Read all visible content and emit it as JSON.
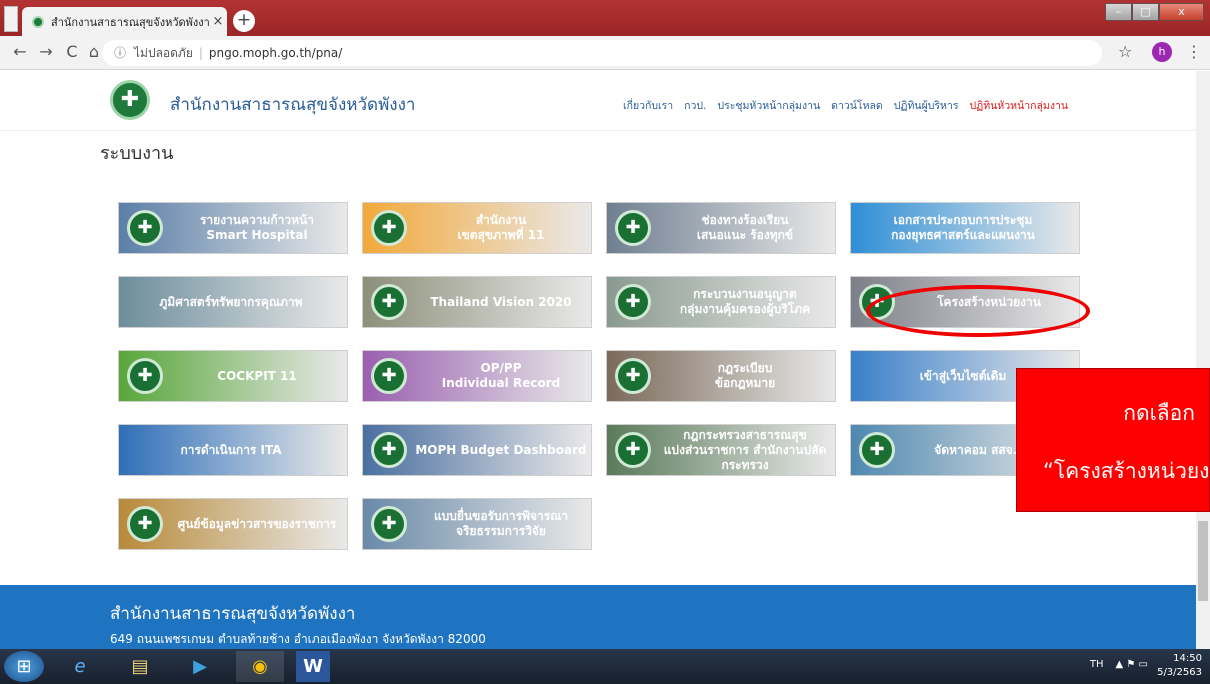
{
  "browser": {
    "tab_title": "สำนักงานสาธารณสุขจังหวัดพังงา",
    "tab_close": "×",
    "new_tab": "+",
    "win_min": "–",
    "win_max": "□",
    "win_close": "x",
    "back": "←",
    "forward": "→",
    "reload": "C",
    "home": "⌂",
    "info_icon": "ⓘ",
    "security_label": "ไม่ปลอดภัย",
    "url": "pngo.moph.go.th/pna/",
    "star": "☆",
    "profile_initial": "h",
    "menu": "⋮"
  },
  "site": {
    "name": "สำนักงานสาธารณสุขจังหวัดพังงา",
    "logo_glyph": "✚",
    "nav": [
      "เกี่ยวกับเรา",
      "กวป.",
      "ประชุมหัวหน้ากลุ่มงาน",
      "ดาวน์โหลด",
      "ปฏิทินผู้บริหาร",
      "ปฏิทินหัวหน้ากลุ่มงาน"
    ],
    "section_title": "ระบบงาน"
  },
  "tiles": [
    {
      "l1": "รายงานความก้าวหน้า",
      "l2": "Smart Hospital",
      "bg": "#5b7fa8",
      "badge": true
    },
    {
      "l1": "สำนักงาน",
      "l2": "เขตสุขภาพที่ 11",
      "bg": "#f2a93b",
      "badge": true
    },
    {
      "l1": "ช่องทางร้องเรียน",
      "l2": "เสนอแนะ ร้องทุกข์",
      "bg": "#6f7f91",
      "badge": true
    },
    {
      "l1": "เอกสารประกอบการประชุม",
      "l2": "กองยุทธศาสตร์และแผนงาน",
      "bg": "#2f8fd6",
      "badge": false
    },
    {
      "l1": "ภูมิศาสตร์ทรัพยากรคุณภาพ",
      "l2": "",
      "bg": "#6d8d9c",
      "badge": false
    },
    {
      "l1": "Thailand Vision 2020",
      "l2": "",
      "bg": "#8c8f7a",
      "badge": true
    },
    {
      "l1": "กระบวนงานอนุญาต",
      "l2": "กลุ่มงานคุ้มครองผู้บริโภค",
      "bg": "#8a9a90",
      "badge": true
    },
    {
      "l1": "โครงสร้างหน่วยงาน",
      "l2": "",
      "bg": "#7d7f88",
      "badge": true
    },
    {
      "l1": "COCKPIT 11",
      "l2": "",
      "bg": "#58a63a",
      "badge": true
    },
    {
      "l1": "OP/PP",
      "l2": "Individual Record",
      "bg": "#9a5fb0",
      "badge": true
    },
    {
      "l1": "กฎระเบียบ",
      "l2": "ข้อกฎหมาย",
      "bg": "#7a6a5a",
      "badge": true
    },
    {
      "l1": "เข้าสู่เว็บไซต์เดิม",
      "l2": "",
      "bg": "#3a7fc9",
      "badge": false
    },
    {
      "l1": "การดำเนินการ ITA",
      "l2": "",
      "bg": "#2f6fb7",
      "badge": false
    },
    {
      "l1": "MOPH Budget Dashboard",
      "l2": "",
      "bg": "#4a6fa0",
      "badge": true
    },
    {
      "l1": "กฎกระทรวงสาธารณสุข",
      "l2": "แบ่งส่วนราชการ สำนักงานปลัดกระทรวง",
      "bg": "#5a7a5a",
      "badge": true
    },
    {
      "l1": "จัดหาคอม สสจ.พังงา",
      "l2": "",
      "bg": "#4f88b0",
      "badge": true
    },
    {
      "l1": "ศูนย์ข้อมูลข่าวสารของราชการ",
      "l2": "",
      "bg": "#b88a3a",
      "badge": true
    },
    {
      "l1": "แบบยื่นขอรับการพิจารณา",
      "l2": "จริยธรรมการวิจัย",
      "bg": "#6a8aa8",
      "badge": true
    }
  ],
  "footer": {
    "title": "สำนักงานสาธารณสุขจังหวัดพังงา",
    "address": "649 ถนนเพชรเกษม ตำบลท้ายช้าง อำเภอเมืองพังงา จังหวัดพังงา 82000"
  },
  "annotation": {
    "line1": "กดเลือก",
    "line2": "“โครงสร้างหน่วยงาน”"
  },
  "taskbar": {
    "start": "⊞",
    "apps": [
      "e",
      "▤",
      "▶",
      "◉",
      "W"
    ],
    "lang": "TH",
    "tray": "▲ ⚑ ▭",
    "time": "14:50",
    "date": "5/3/2563"
  }
}
